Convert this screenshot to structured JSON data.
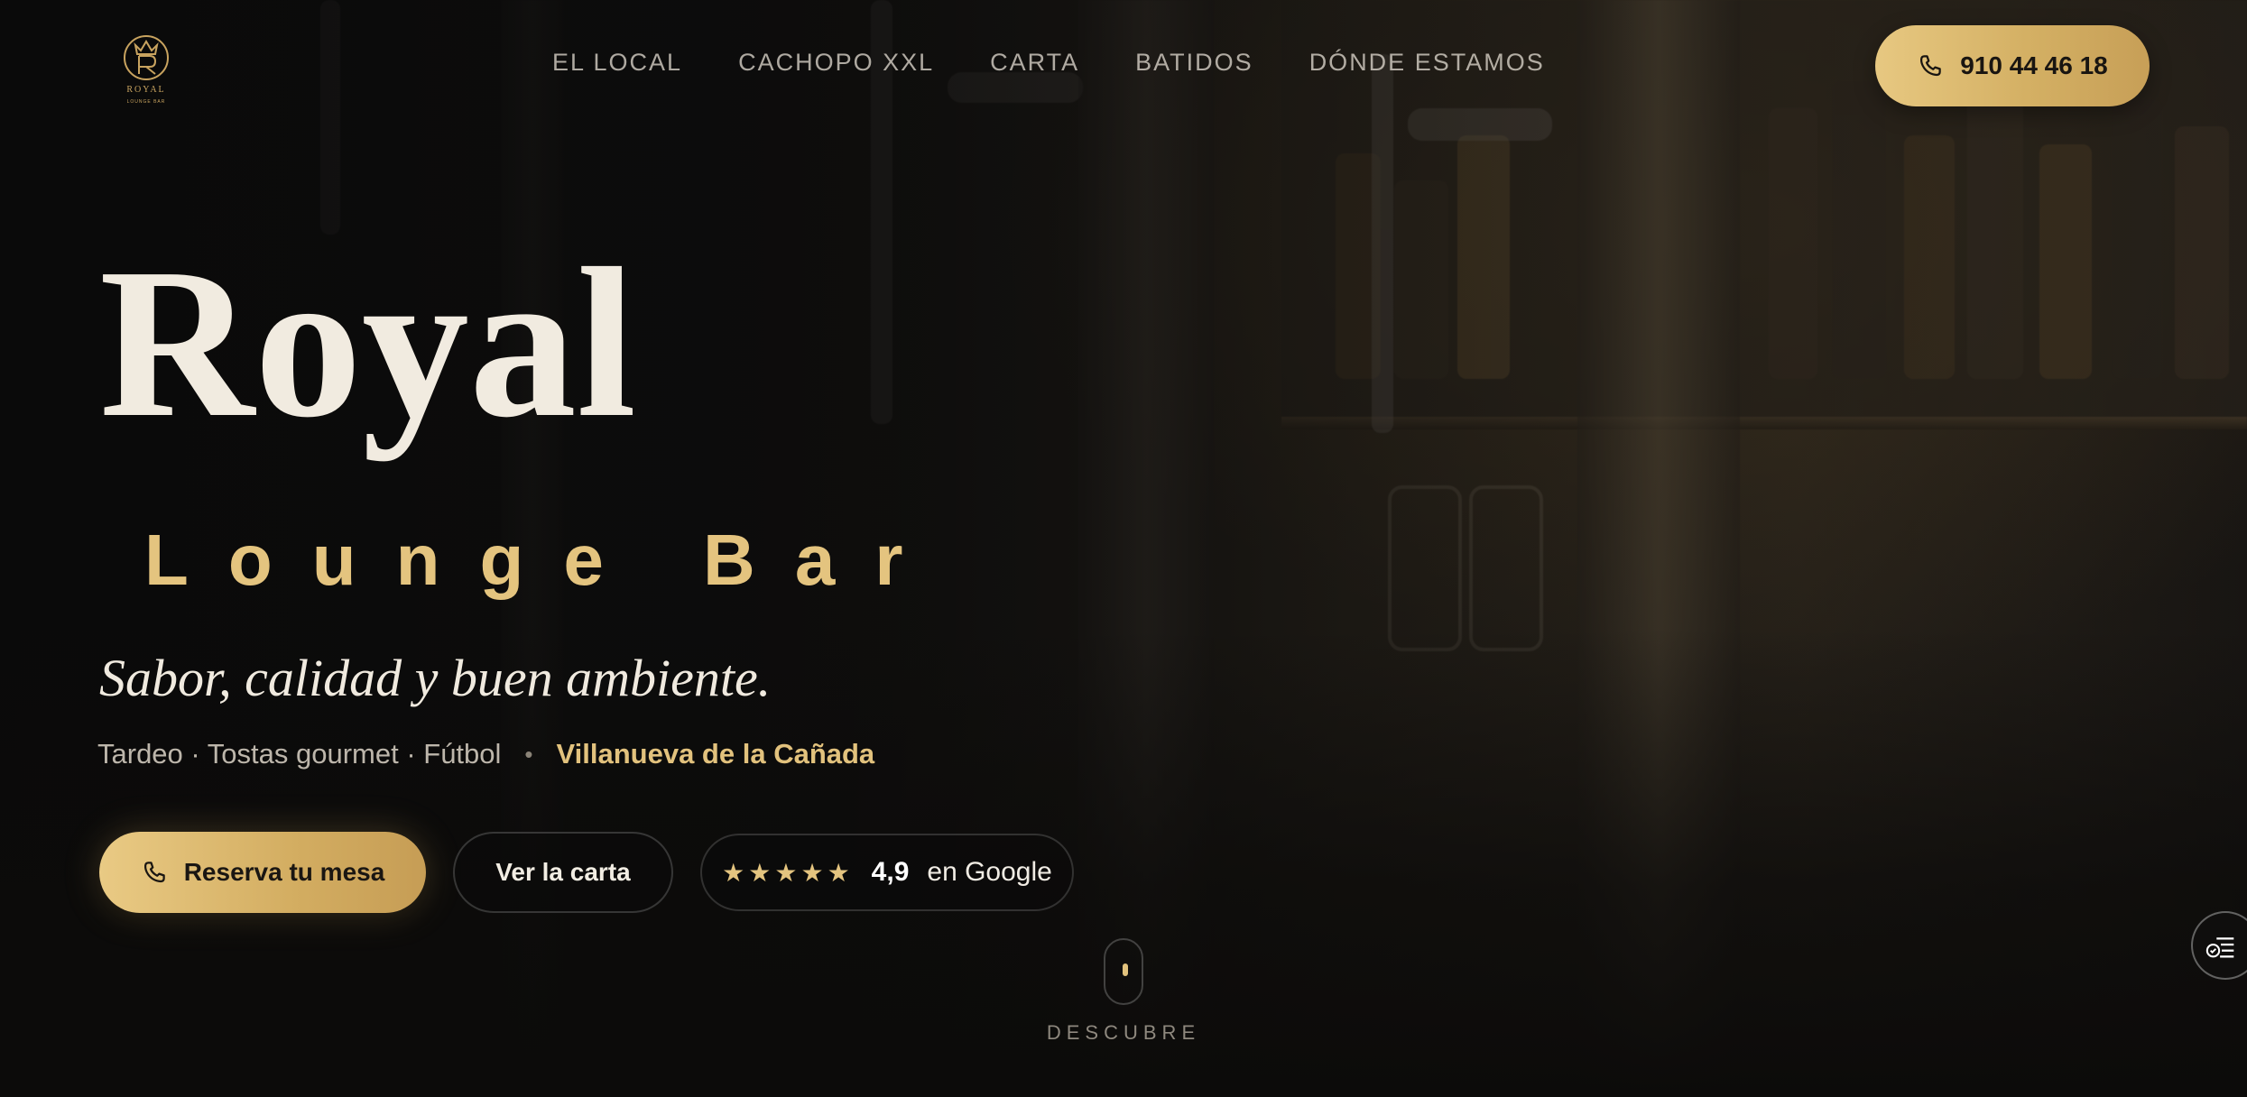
{
  "brand": {
    "logo_icon": "royal-crown-logo",
    "logo_text": "ROYAL",
    "logo_subtext": "LOUNGE BAR",
    "accent_color": "#d9b86b"
  },
  "nav": {
    "items": [
      {
        "label": "EL LOCAL"
      },
      {
        "label": "CACHOPO XXL"
      },
      {
        "label": "CARTA"
      },
      {
        "label": "BATIDOS"
      },
      {
        "label": "DÓNDE ESTAMOS"
      }
    ]
  },
  "header": {
    "phone_label": "910 44 46 18",
    "phone_icon": "phone-icon"
  },
  "hero": {
    "title": "Royal",
    "subtitle": "Lounge Bar",
    "tagline": "Sabor, calidad y buen ambiente.",
    "features_text": "Tardeo · Tostas gourmet · Fútbol",
    "separator": "•",
    "location": "Villanueva de la Cañada"
  },
  "cta": {
    "reserve_label": "Reserva tu mesa",
    "menu_label": "Ver la carta",
    "rating_stars": "★★★★★",
    "rating_value": "4,9",
    "rating_source": "en Google"
  },
  "scroll": {
    "label": "DESCUBRE"
  },
  "side_button": {
    "icon": "accessibility-menu-icon"
  }
}
